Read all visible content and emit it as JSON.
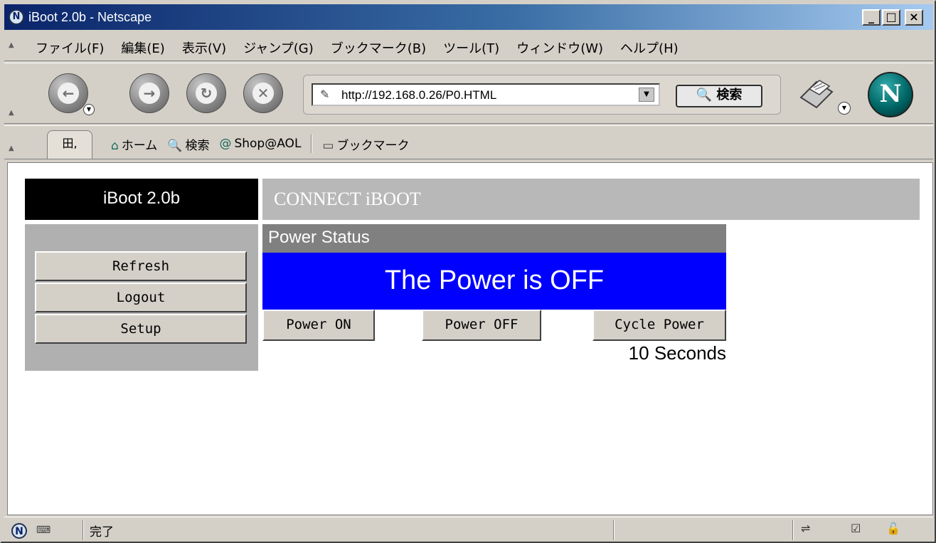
{
  "window": {
    "title": "iBoot 2.0b - Netscape",
    "app_icon": "N",
    "controls": {
      "minimize": "_",
      "maximize": "□",
      "close": "×"
    }
  },
  "menubar": {
    "items": [
      "ファイル(F)",
      "編集(E)",
      "表示(V)",
      "ジャンプ(G)",
      "ブックマーク(B)",
      "ツール(T)",
      "ウィンドウ(W)",
      "ヘルプ(H)"
    ]
  },
  "navbar": {
    "back_icon": "back-arrow-icon",
    "forward_icon": "forward-arrow-icon",
    "reload_icon": "reload-icon",
    "stop_icon": "stop-icon",
    "url": "http://192.168.0.26/P0.HTML",
    "search_label": "検索",
    "logo_letter": "N"
  },
  "personalbar": {
    "tab_label": "田,",
    "home_label": "ホーム",
    "search_label": "検索",
    "shop_label": "Shop@AOL",
    "bookmarks_label": "ブックマーク"
  },
  "page": {
    "brand": "iBoot 2.0b",
    "header_title": "CONNECT iBOOT",
    "sidebar": {
      "refresh": "Refresh",
      "logout": "Logout",
      "setup": "Setup"
    },
    "panel_title": "Power Status",
    "power_state": "The Power is OFF",
    "buttons": {
      "power_on": "Power ON",
      "power_off": "Power OFF",
      "cycle_power": "Cycle Power"
    },
    "cycle_note": "10 Seconds"
  },
  "statusbar": {
    "text": "完了"
  },
  "colors": {
    "power_state_bg": "#0000ff",
    "title_gradient_start": "#0a246a",
    "brand_bg": "#000000",
    "panel_head_bg": "#808080"
  }
}
